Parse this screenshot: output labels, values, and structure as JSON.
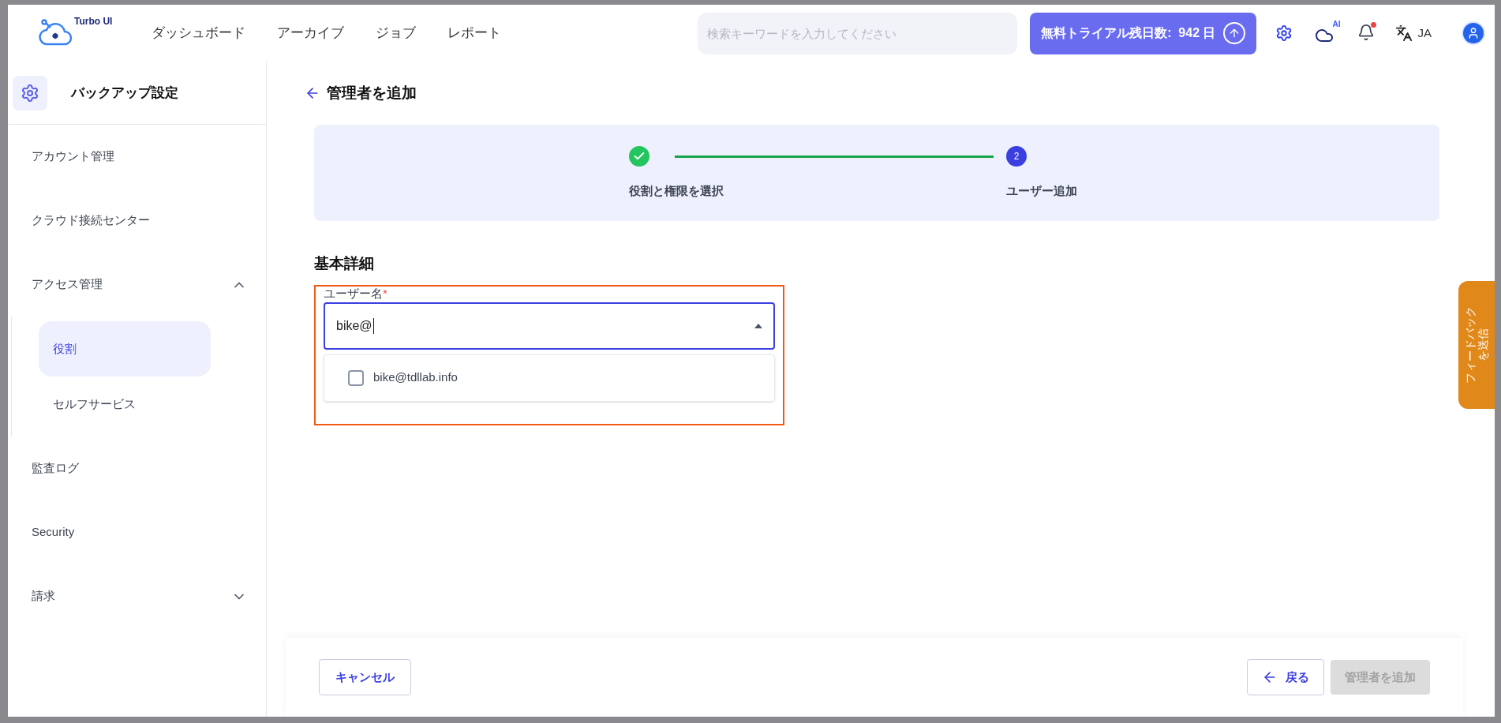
{
  "header": {
    "logo_text": "Turbo UI",
    "nav": [
      {
        "label": "ダッシュボード"
      },
      {
        "label": "アーカイブ"
      },
      {
        "label": "ジョブ"
      },
      {
        "label": "レポート"
      }
    ],
    "search": {
      "placeholder": "検索キーワードを入力してください"
    },
    "trial_button": "無料トライアル残日数:  942 日",
    "ai_badge": "AI",
    "notification_dot": true,
    "language": "JA"
  },
  "sidebar": {
    "title": "バックアップ設定",
    "items": [
      {
        "label": "アカウント管理",
        "selected": false
      },
      {
        "label": "クラウド接続センター",
        "selected": false
      },
      {
        "label": "アクセス管理",
        "selected": false,
        "expanded": true,
        "children": [
          {
            "label": "役割",
            "selected": true
          },
          {
            "label": "セルフサービス",
            "selected": false
          }
        ]
      },
      {
        "label": "監査ログ",
        "selected": false
      },
      {
        "label": "Security",
        "selected": false
      },
      {
        "label": "請求",
        "selected": false,
        "expanded": false
      }
    ]
  },
  "page": {
    "title": "管理者を追加",
    "steps": [
      {
        "label": "役割と権限を選択",
        "completed": true
      },
      {
        "label": "ユーザー追加",
        "number": "2",
        "completed": false
      }
    ],
    "section_title": "基本詳細",
    "field": {
      "label": "ユーザー名",
      "required_mark": "*",
      "value": "bike@",
      "options": [
        {
          "label": "bike@tdllab.info",
          "checked": false
        }
      ]
    }
  },
  "footer": {
    "cancel": "キャンセル",
    "back": "戻る",
    "submit": {
      "label": "管理者を追加",
      "disabled": true
    }
  },
  "feedback_tab": {
    "lines": [
      "フィードバック",
      "を送信"
    ]
  }
}
